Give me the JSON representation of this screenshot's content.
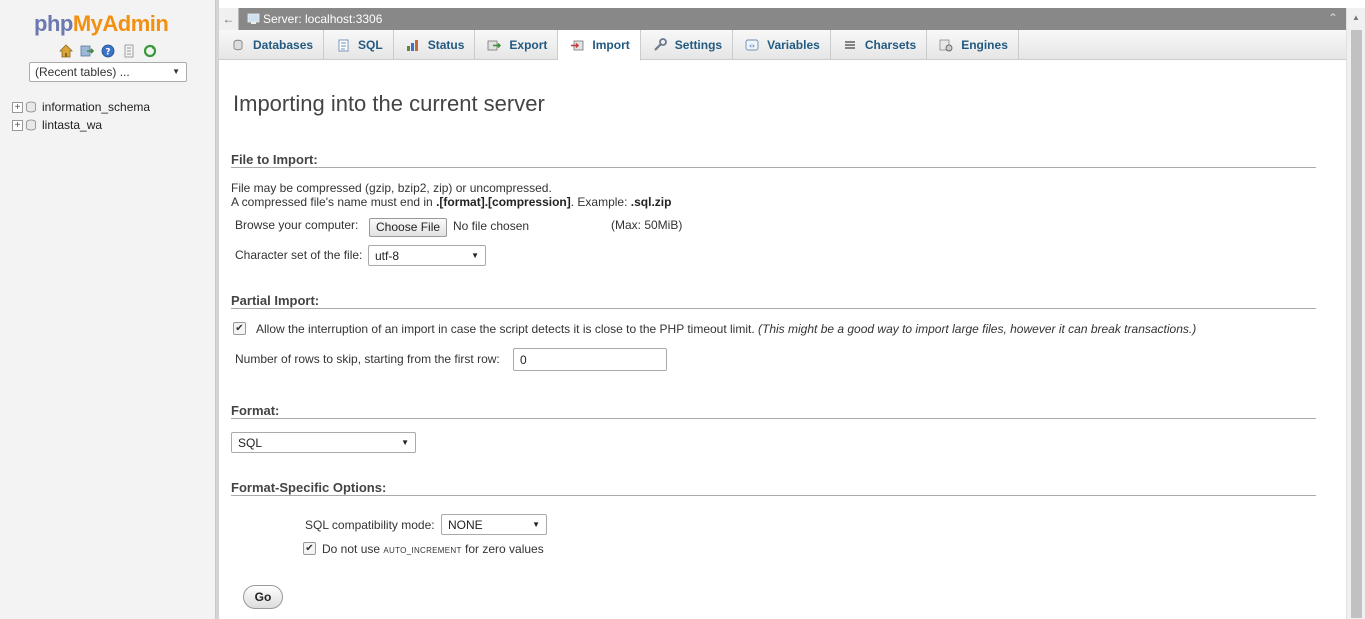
{
  "sidebar": {
    "logo": {
      "php": "php",
      "my": "My",
      "admin": "Admin"
    },
    "quick_links": [
      "home-icon",
      "logout-icon",
      "help-icon",
      "docs-icon",
      "reload-icon"
    ],
    "recent_tables": "(Recent tables) ...",
    "databases": [
      {
        "name": "information_schema"
      },
      {
        "name": "lintasta_wa"
      }
    ]
  },
  "topbar": {
    "back_symbol": "←",
    "title": "Server: localhost:3306",
    "collapse_symbol": "⌃"
  },
  "tabs": [
    {
      "label": "Databases",
      "icon": "database-icon"
    },
    {
      "label": "SQL",
      "icon": "sql-icon"
    },
    {
      "label": "Status",
      "icon": "status-icon"
    },
    {
      "label": "Export",
      "icon": "export-icon"
    },
    {
      "label": "Import",
      "icon": "import-icon",
      "active": true
    },
    {
      "label": "Settings",
      "icon": "settings-icon"
    },
    {
      "label": "Variables",
      "icon": "variables-icon"
    },
    {
      "label": "Charsets",
      "icon": "charsets-icon"
    },
    {
      "label": "Engines",
      "icon": "engines-icon"
    }
  ],
  "main": {
    "title": "Importing into the current server",
    "file_section": {
      "legend": "File to Import:",
      "line1": "File may be compressed (gzip, bzip2, zip) or uncompressed.",
      "line2_prefix": "A compressed file's name must end in ",
      "line2_bold": ".[format].[compression]",
      "line2_mid": ". Example: ",
      "line2_example": ".sql.zip",
      "browse_label": "Browse your computer:",
      "choose_file": "Choose File",
      "no_file": "No file chosen",
      "max_size": "(Max: 50MiB)",
      "charset_label": "Character set of the file:",
      "charset_value": "utf-8"
    },
    "partial_section": {
      "legend": "Partial Import:",
      "allow_interrupt_checked": true,
      "allow_interrupt_label": "Allow the interruption of an import in case the script detects it is close to the PHP timeout limit.",
      "allow_interrupt_note": "(This might be a good way to import large files, however it can break transactions.)",
      "skip_rows_label": "Number of rows to skip, starting from the first row:",
      "skip_rows_value": "0"
    },
    "format_section": {
      "legend": "Format:",
      "format_value": "SQL"
    },
    "format_options": {
      "legend": "Format-Specific Options:",
      "compat_label": "SQL compatibility mode:",
      "compat_value": "NONE",
      "no_auto_inc_checked": true,
      "no_auto_inc_prefix": "Do not use",
      "no_auto_inc_code": "AUTO_INCREMENT",
      "no_auto_inc_suffix": "for zero values"
    },
    "go_label": "Go"
  }
}
